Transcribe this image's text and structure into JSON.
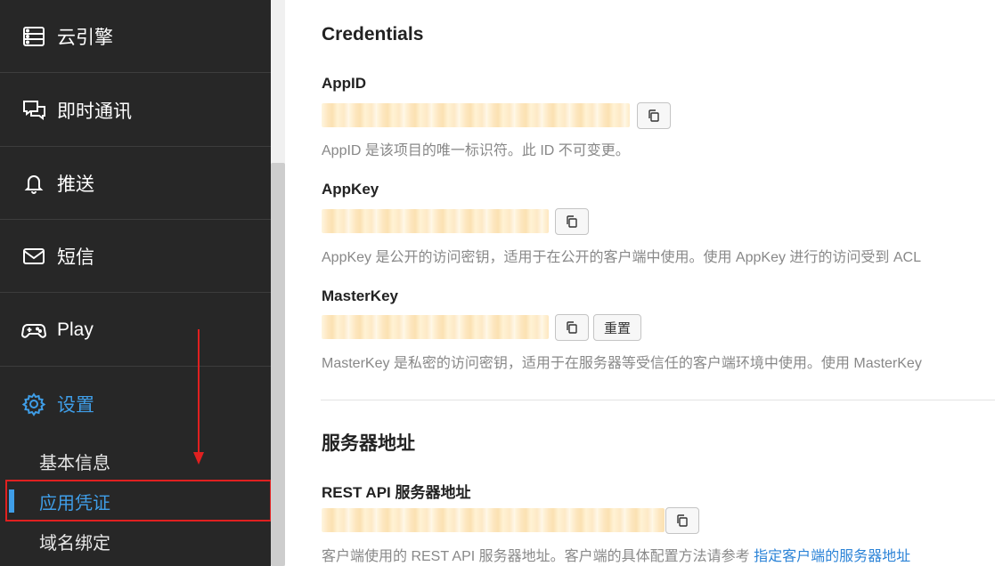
{
  "sidebar": {
    "items": [
      {
        "label": "云引擎",
        "icon": "server-icon"
      },
      {
        "label": "即时通讯",
        "icon": "chat-icon"
      },
      {
        "label": "推送",
        "icon": "bell-icon"
      },
      {
        "label": "短信",
        "icon": "envelope-icon"
      },
      {
        "label": "Play",
        "icon": "gamepad-icon"
      },
      {
        "label": "设置",
        "icon": "gear-icon"
      }
    ],
    "subitems": [
      {
        "label": "基本信息"
      },
      {
        "label": "应用凭证"
      },
      {
        "label": "域名绑定"
      }
    ],
    "active_color": "#3f9ee8"
  },
  "main": {
    "credentials_title": "Credentials",
    "appid": {
      "label": "AppID",
      "value": "",
      "desc": "AppID 是该项目的唯一标识符。此 ID 不可变更。"
    },
    "appkey": {
      "label": "AppKey",
      "value": "",
      "desc": "AppKey 是公开的访问密钥，适用于在公开的客户端中使用。使用 AppKey 进行的访问受到 ACL"
    },
    "masterkey": {
      "label": "MasterKey",
      "value": "",
      "reset_label": "重置",
      "desc": "MasterKey 是私密的访问密钥，适用于在服务器等受信任的客户端环境中使用。使用 MasterKey"
    },
    "server_title": "服务器地址",
    "rest": {
      "label": "REST API 服务器地址",
      "value": "",
      "desc": "客户端使用的 REST API 服务器地址。客户端的具体配置方法请参考",
      "link": "指定客户端的服务器地址"
    }
  },
  "colors": {
    "annotation": "#e02020",
    "link": "#2b83d7"
  }
}
